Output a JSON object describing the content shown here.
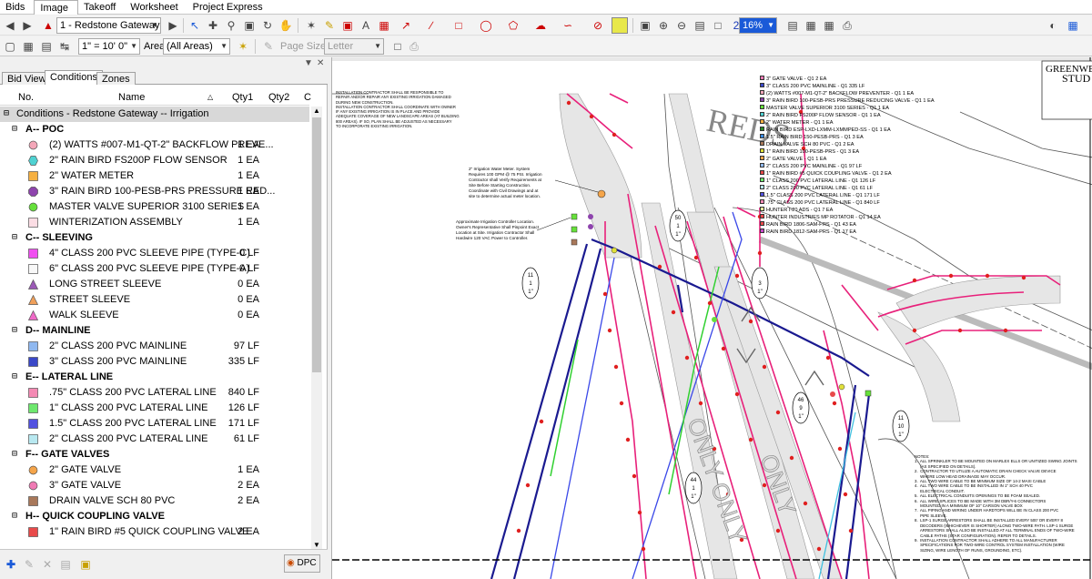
{
  "menu": {
    "tabs": [
      "Bids",
      "Image",
      "Takeoff",
      "Worksheet",
      "Project Express"
    ],
    "active": "Image"
  },
  "toolbar": {
    "page_select": "1 - Redstone Gateway Bl",
    "zoom": "16%",
    "scale": "1\" = 10' 0\"",
    "area_label": "Area",
    "area_value": "(All Areas)",
    "page_size_label": "Page Size",
    "page_size_value": "Letter"
  },
  "panel": {
    "tabs": [
      "Bid View",
      "Conditions",
      "Zones"
    ],
    "active_tab": "Conditions",
    "columns": {
      "no": "No.",
      "name": "Name",
      "qty1": "Qty1",
      "qty2": "Qty2",
      "extra": "C"
    },
    "group_title": "Conditions - Redstone Gateway -- Irrigation",
    "sections": [
      {
        "title": "A-- POC",
        "items": [
          {
            "name": "(2) WATTS #007-M1-QT-2\" BACKFLOW PREVE...",
            "qty": "1 EA",
            "icon": "circle",
            "color": "#f4a7b9"
          },
          {
            "name": "2\" RAIN BIRD FS200P FLOW SENSOR",
            "qty": "1 EA",
            "icon": "hexagon",
            "color": "#4fd2d2"
          },
          {
            "name": "2\" WATER METER",
            "qty": "1 EA",
            "icon": "square",
            "color": "#f5b041"
          },
          {
            "name": "3\" RAIN BIRD 100-PESB-PRS PRESSURE RED...",
            "qty": "1 EA",
            "icon": "octagon",
            "color": "#8e44ad"
          },
          {
            "name": "MASTER VALVE SUPERIOR 3100 SERIES",
            "qty": "1 EA",
            "icon": "circle",
            "color": "#66e03a"
          },
          {
            "name": "WINTERIZATION ASSEMBLY",
            "qty": "1 EA",
            "icon": "square",
            "color": "#fbdde4"
          }
        ]
      },
      {
        "title": "C-- SLEEVING",
        "items": [
          {
            "name": "4\" CLASS 200 PVC SLEEVE PIPE (TYPE-C)",
            "qty": "0 LF",
            "icon": "square",
            "color": "#f04ef0"
          },
          {
            "name": "6\" CLASS 200 PVC SLEEVE PIPE (TYPE-A)",
            "qty": "0 LF",
            "icon": "square",
            "color": "#f8f8f8"
          },
          {
            "name": "LONG STREET SLEEVE",
            "qty": "0 EA",
            "icon": "triangle",
            "color": "#9b59b6"
          },
          {
            "name": "STREET SLEEVE",
            "qty": "0 EA",
            "icon": "triangle",
            "color": "#f0a05a"
          },
          {
            "name": "WALK SLEEVE",
            "qty": "0 EA",
            "icon": "triangle",
            "color": "#f06ac8"
          }
        ]
      },
      {
        "title": "D-- MAINLINE",
        "items": [
          {
            "name": "2\" CLASS 200 PVC MAINLINE",
            "qty": "97 LF",
            "icon": "square",
            "color": "#8fb8f0"
          },
          {
            "name": "3\" CLASS 200 PVC MAINLINE",
            "qty": "335 LF",
            "icon": "square",
            "color": "#3a48c8"
          }
        ]
      },
      {
        "title": "E-- LATERAL LINE",
        "items": [
          {
            "name": ".75\" CLASS 200 PVC LATERAL LINE",
            "qty": "840 LF",
            "icon": "square",
            "color": "#f48ab4"
          },
          {
            "name": "1\" CLASS 200 PVC LATERAL LINE",
            "qty": "126 LF",
            "icon": "square",
            "color": "#6ee86e"
          },
          {
            "name": "1.5\" CLASS 200 PVC LATERAL LINE",
            "qty": "171 LF",
            "icon": "square",
            "color": "#5252e0"
          },
          {
            "name": "2\" CLASS 200 PVC LATERAL LINE",
            "qty": "61 LF",
            "icon": "square",
            "color": "#b8e8f0"
          }
        ]
      },
      {
        "title": "F-- GATE VALVES",
        "items": [
          {
            "name": "2\" GATE VALVE",
            "qty": "1 EA",
            "icon": "circle",
            "color": "#f5a54a"
          },
          {
            "name": "3\" GATE VALVE",
            "qty": "2 EA",
            "icon": "circle",
            "color": "#f07ab4"
          },
          {
            "name": "DRAIN VALVE SCH 80 PVC",
            "qty": "2 EA",
            "icon": "square",
            "color": "#a8785a"
          }
        ]
      },
      {
        "title": "H-- QUICK COUPLING VALVE",
        "items": [
          {
            "name": "1\" RAIN BIRD #5 QUICK COUPLING VALVE",
            "qty": "2 EA",
            "icon": "square",
            "color": "#e84a4a"
          }
        ]
      }
    ],
    "dpc_label": "DPC"
  },
  "drawing": {
    "title_block": [
      "GREENWE",
      "STUD"
    ],
    "road_text": "REDS",
    "only_texts": [
      "ONLY ONLY",
      "ONLY"
    ],
    "legend": [
      "3\" GATE VALVE - Q1 2 EA",
      "3\" CLASS 200 PVC MAINLINE - Q1 335 LF",
      "(2) WATTS #007-M1-QT-2\" BACKFLOW PREVENTER - Q1 1 EA",
      "3\" RAIN BIRD 100-PESB-PRS PRESSURE REDUCING VALVE - Q1 1 EA",
      "MASTER VALVE SUPERIOR 3100 SERIES - Q1 1 EA",
      "2\" RAIN BIRD FS200P FLOW SENSOR - Q1 1 EA",
      "2\" WATER METER - Q1 1 EA",
      "RAIN BIRD ESP-LXD-LXMM-LXMMPED-SS - Q1 1 EA",
      "1.5\" RAIN BIRD 150-PESB-PRS - Q1 3 EA",
      "DRAIN VALVE SCH 80 PVC - Q1 2 EA",
      "1\" RAIN BIRD 100-PESB-PRS - Q1 3 EA",
      "2\" GATE VALVE - Q1 1 EA",
      "2\" CLASS 200 PVC MAINLINE - Q1 97 LF",
      "1\" RAIN BIRD #5 QUICK COUPLING VALVE - Q1 2 EA",
      "1\" CLASS 200 PVC LATERAL LINE - Q1 126 LF",
      "2\" CLASS 200 PVC LATERAL LINE - Q1 61 LF",
      "1.5\" CLASS 200 PVC LATERAL LINE - Q1 171 LF",
      ".75\" CLASS 200 PVC LATERAL LINE - Q1 840 LF",
      "HUNTER I-20 ADS - Q1 7 EA",
      "HUNTER INDUSTRIES MP ROTATOR - Q1 14 EA",
      "RAIN BIRD 1806-SAM-PRS - Q1 43 EA",
      "RAIN BIRD 1812-SAM-PRS - Q1 17 EA"
    ],
    "legend_colors": [
      "#f07ab4",
      "#3a48c8",
      "#f4a7b9",
      "#8e44ad",
      "#66e03a",
      "#4fd2d2",
      "#f5b041",
      "#2a8a2a",
      "#3a8ae0",
      "#a8785a",
      "#e0e03a",
      "#f5a54a",
      "#8fb8f0",
      "#e84a4a",
      "#6ee86e",
      "#b8e8f0",
      "#5252e0",
      "#f48ab4",
      "#f0f0a0",
      "#e84a4a",
      "#e84a4a",
      "#c84ac8"
    ],
    "note1": [
      "INSTALLATION CONTRACTOR SHALL BE RESPONSIBLE TO",
      "REPAIR AND/OR REPAIR ANY EXISTING IRRIGATION DAMAGED",
      "DURING NEW CONSTRUCTION.",
      "INSTALLATION CONTRACTOR SHALL COORDINATE WITH OWNER",
      "IF ANY EXISTING IRRIGATION IS IN PLACE AND PROVIDE",
      "ADEQUATE COVERAGE OF NEW LANDSCAPE AREAS (AT BUILDING",
      "800 AREAS). IF SO, PLAN SHALL BE ADJUSTED AS NECESSARY",
      "TO INCORPORATE EXISTING IRRIGATION."
    ],
    "note2": [
      "2\" Irrigation Water Meter. System",
      "Requires 100 GPM @ 75 PSI. Irrigation",
      "Contractor shall Verify Requirements at",
      "Site Before Starting Construction.",
      "Coordinate with Civil Drawings and at",
      "site to determine actual meter location."
    ],
    "note3": [
      "Approximate Irrigation Controller Location.",
      "Owner's Representative Shall Pinpoint Exact",
      "Location at Site. Irrigation Contractor Shall",
      "Hardwire 120 VAC Power to Controller."
    ],
    "notes_title": "NOTES:",
    "notes": [
      "1.  ALL SPRINKLER TO BE MOUNTED ON MARLEX ELLS OR UNITIZED SWING JOINTS",
      "     (AS SPECIFIED ON DETAILS).",
      "2.  CONTRACTOR TO UTILIZE A AUTOMATIC DRAIN CHECK VALVE DEVICE",
      "     WHERE LOW HEAD DRAINAGE MAY OCCUR.",
      "3.  ALL TWO WIRE CABLE TO BE MINIMUM SIZE OF 14-2 MAXI CABLE",
      "4.  ALL TWO WIRE CABLE TO BE INSTALLED IN 1\" SCH 40 PVC",
      "     ELECTRICAL CONDUIT.",
      "5.  ALL ELECTRICAL CONDUITS OPENINGS TO BE FOAM SEALED.",
      "6.  ALL WIRE SPLICES TO BE MADE WITH 3M DBR/Y-6 CONNECTORS",
      "     MOUNTED IN A MINIMUM OF 10\" CARSON VALVE BOX",
      "7.  ALL PIPING AND WIRING UNDER HARDTOPS WILL BE IN CLASS 200 PVC",
      "     PIPE SLEEVE.",
      "8.  LSP-1 SURGE ARRESTORS SHALL BE INSTALLED EVERY 500' OR EVERY 8",
      "     DECODERS (WHICHEVER IS SHORTER) ALONG TWO-WIRE PATH. LSP-1 SURGE",
      "     ARRESTORS SHALL ALSO BE INSTALLED AT ALL TERMINAL ENDS OF TWO-WIRE",
      "     CABLE PATHS (STAR CONFIGURATION). REFER TO DETAILS.",
      "9.  INSTALLATION CONTRACTOR SHALL ADHERE TO ALL MANUFACTURER",
      "     SPECIFICATIONS FOR TWO-WIRE CONTROL SYSTEM INSTALLATION (WIRE",
      "     SIZING, WIRE LENGTH OF RUNS, GROUNDING, ETC)."
    ],
    "callouts": [
      {
        "top": "50",
        "mid": "1",
        "bot": "1\""
      },
      {
        "top": "11",
        "mid": "1",
        "bot": "1\""
      },
      {
        "top": "",
        "mid": "3",
        "bot": "1\""
      },
      {
        "top": "46",
        "mid": "9",
        "bot": "1\""
      },
      {
        "top": "11",
        "mid": "10",
        "bot": "1\""
      },
      {
        "top": "44",
        "mid": "1",
        "bot": "1\""
      }
    ]
  }
}
